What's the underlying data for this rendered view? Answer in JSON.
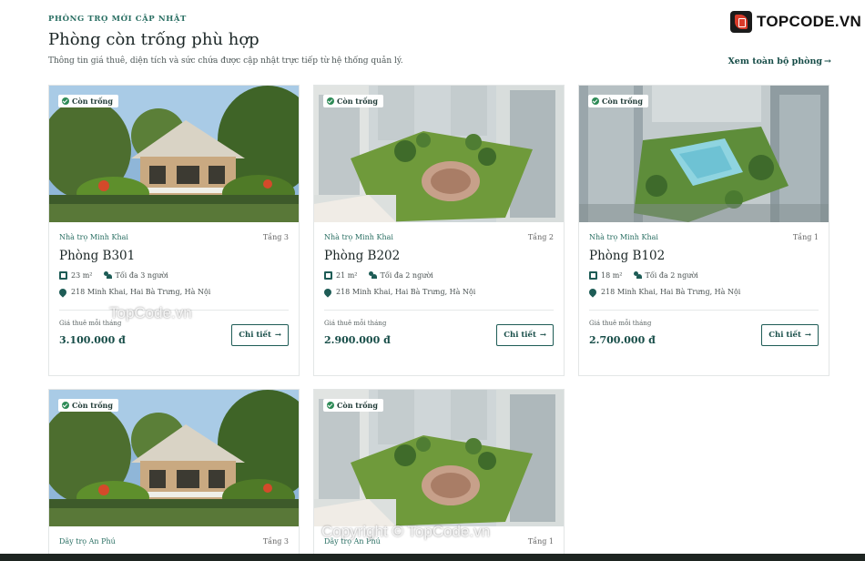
{
  "header": {
    "eyebrow": "PHÒNG TRỌ MỚI CẬP NHẬT",
    "title": "Phòng còn trống phù hợp",
    "subtitle": "Thông tin giá thuê, diện tích và sức chứa được cập nhật trực tiếp từ hệ thống quản lý.",
    "view_all": "Xem toàn bộ phòng"
  },
  "logo": {
    "text": "TOPCODE.VN"
  },
  "watermarks": {
    "top": "TopCode.vn",
    "bottom": "Copyright © TopCode.vn"
  },
  "rooms": [
    {
      "badge": "Còn trống",
      "owner": "Nhà trọ Minh Khai",
      "floor": "Tầng 3",
      "name": "Phòng B301",
      "area": "23 m²",
      "capacity": "Tối đa 3 người",
      "address": "218 Minh Khai, Hai Bà Trưng, Hà Nội",
      "price_label": "Giá thuê mỗi tháng",
      "price": "3.100.000 đ",
      "detail": "Chi tiết",
      "image": "house"
    },
    {
      "badge": "Còn trống",
      "owner": "Nhà trọ Minh Khai",
      "floor": "Tầng 2",
      "name": "Phòng B202",
      "area": "21 m²",
      "capacity": "Tối đa 2 người",
      "address": "218 Minh Khai, Hai Bà Trưng, Hà Nội",
      "price_label": "Giá thuê mỗi tháng",
      "price": "2.900.000 đ",
      "detail": "Chi tiết",
      "image": "garden"
    },
    {
      "badge": "Còn trống",
      "owner": "Nhà trọ Minh Khai",
      "floor": "Tầng 1",
      "name": "Phòng B102",
      "area": "18 m²",
      "capacity": "Tối đa 2 người",
      "address": "218 Minh Khai, Hai Bà Trưng, Hà Nội",
      "price_label": "Giá thuê mỗi tháng",
      "price": "2.700.000 đ",
      "detail": "Chi tiết",
      "image": "pool"
    },
    {
      "badge": "Còn trống",
      "owner": "Dãy trọ An Phú",
      "floor": "Tầng 3",
      "image": "house"
    },
    {
      "badge": "Còn trống",
      "owner": "Dãy trọ An Phú",
      "floor": "Tầng 1",
      "image": "garden"
    }
  ]
}
